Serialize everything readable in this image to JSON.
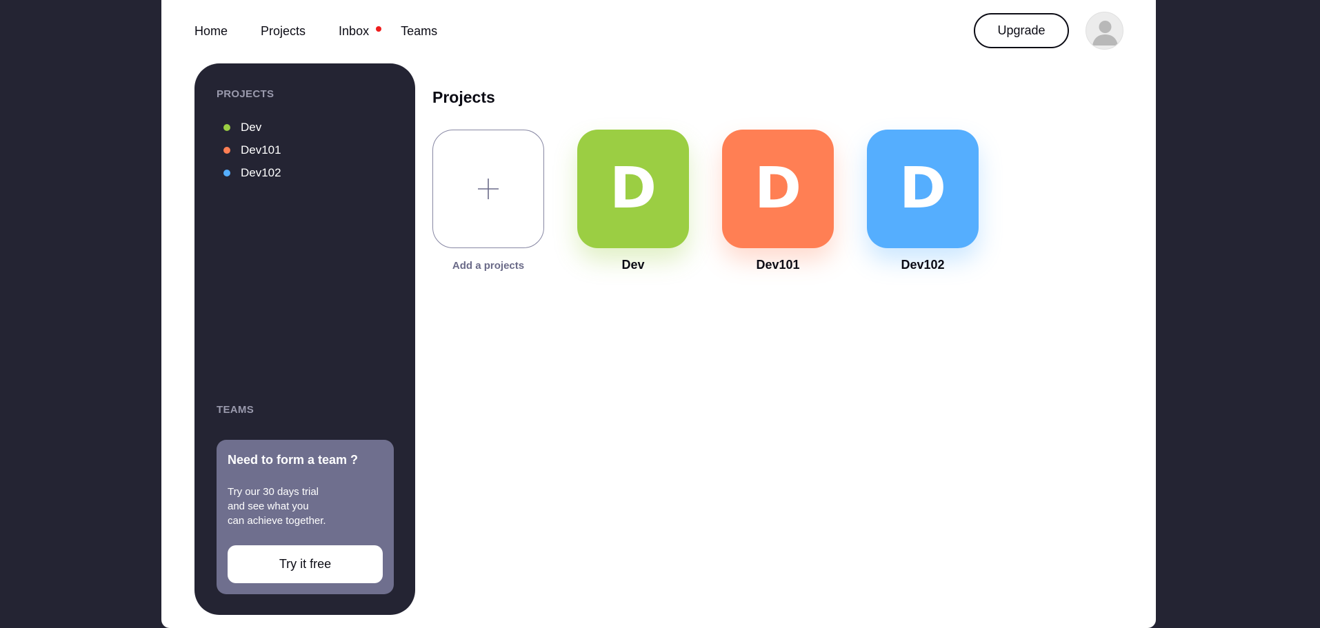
{
  "nav": {
    "items": [
      {
        "label": "Home"
      },
      {
        "label": "Projects"
      },
      {
        "label": "Inbox"
      },
      {
        "label": "Teams"
      }
    ],
    "upgrade_label": "Upgrade"
  },
  "sidebar": {
    "projects_heading": "PROJECTS",
    "projects": [
      {
        "label": "Dev",
        "color": "#9bce43"
      },
      {
        "label": "Dev101",
        "color": "#ff7f54"
      },
      {
        "label": "Dev102",
        "color": "#55aefe"
      }
    ],
    "teams_heading": "TEAMS",
    "team_card": {
      "title": "Need to form a team ?",
      "text_lines": [
        "Try our 30 days trial",
        "and see what you",
        "can achieve together."
      ],
      "button_label": "Try it free"
    }
  },
  "main": {
    "title": "Projects",
    "add_label": "Add a projects",
    "projects": [
      {
        "name": "Dev",
        "initial": "D",
        "color": "#9bce43"
      },
      {
        "name": "Dev101",
        "initial": "D",
        "color": "#ff7f54"
      },
      {
        "name": "Dev102",
        "initial": "D",
        "color": "#55aefe"
      }
    ]
  },
  "colors": {
    "background": "#242433",
    "notification_dot": "#ee1d1d",
    "team_card": "#6f6f8e"
  }
}
